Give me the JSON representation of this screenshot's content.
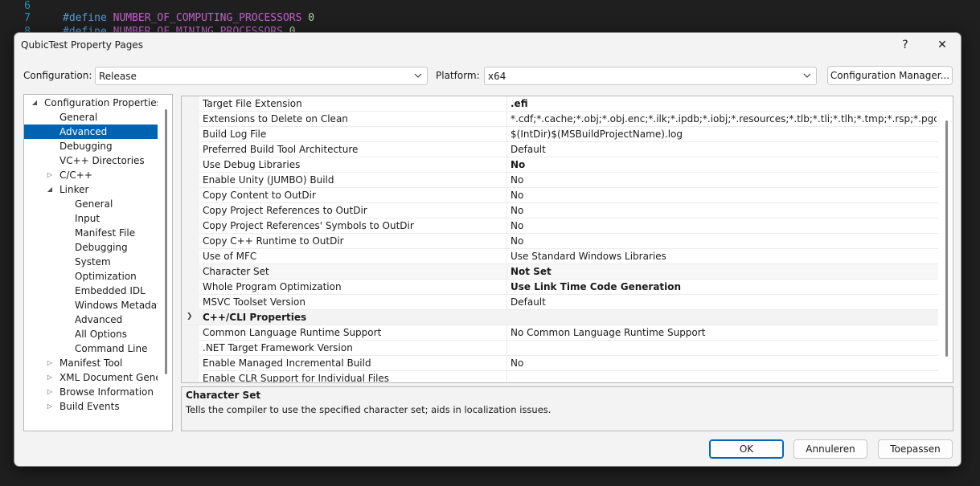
{
  "editor": {
    "lines": [
      {
        "number": "6",
        "keyword": "",
        "identifier": "",
        "value": ""
      },
      {
        "number": "7",
        "keyword": "#define",
        "identifier": "NUMBER_OF_COMPUTING_PROCESSORS",
        "value": "0"
      },
      {
        "number": "8",
        "keyword": "#define",
        "identifier": "NUMBER_OF_MINING_PROCESSORS",
        "value": "0"
      }
    ]
  },
  "dialog": {
    "title": "QubicTest Property Pages",
    "help_glyph": "?",
    "close_glyph": "✕",
    "configuration_label": "Configuration:",
    "configuration_value": "Release",
    "platform_label": "Platform:",
    "platform_value": "x64",
    "config_manager_label": "Configuration Manager..."
  },
  "tree": {
    "items": [
      {
        "label": "Configuration Properties",
        "expander": "◢"
      },
      {
        "label": "General",
        "expander": ""
      },
      {
        "label": "Advanced",
        "expander": ""
      },
      {
        "label": "Debugging",
        "expander": ""
      },
      {
        "label": "VC++ Directories",
        "expander": ""
      },
      {
        "label": "C/C++",
        "expander": "▷"
      },
      {
        "label": "Linker",
        "expander": "◢"
      },
      {
        "label": "General",
        "expander": ""
      },
      {
        "label": "Input",
        "expander": ""
      },
      {
        "label": "Manifest File",
        "expander": ""
      },
      {
        "label": "Debugging",
        "expander": ""
      },
      {
        "label": "System",
        "expander": ""
      },
      {
        "label": "Optimization",
        "expander": ""
      },
      {
        "label": "Embedded IDL",
        "expander": ""
      },
      {
        "label": "Windows Metadata",
        "expander": ""
      },
      {
        "label": "Advanced",
        "expander": ""
      },
      {
        "label": "All Options",
        "expander": ""
      },
      {
        "label": "Command Line",
        "expander": ""
      },
      {
        "label": "Manifest Tool",
        "expander": "▷"
      },
      {
        "label": "XML Document Genera",
        "expander": "▷"
      },
      {
        "label": "Browse Information",
        "expander": "▷"
      },
      {
        "label": "Build Events",
        "expander": "▷"
      }
    ]
  },
  "grid": {
    "rows": [
      {
        "name": "Target File Extension",
        "value": ".efi",
        "bold": true
      },
      {
        "name": "Extensions to Delete on Clean",
        "value": "*.cdf;*.cache;*.obj;*.obj.enc;*.ilk;*.ipdb;*.iobj;*.resources;*.tlb;*.tli;*.tlh;*.tmp;*.rsp;*.pgc;*.pgd;*.meta;*",
        "bold": false
      },
      {
        "name": "Build Log File",
        "value": "$(IntDir)$(MSBuildProjectName).log",
        "bold": false
      },
      {
        "name": "Preferred Build Tool Architecture",
        "value": "Default",
        "bold": false
      },
      {
        "name": "Use Debug Libraries",
        "value": "No",
        "bold": true
      },
      {
        "name": "Enable Unity (JUMBO) Build",
        "value": "No",
        "bold": false
      },
      {
        "name": "Copy Content to OutDir",
        "value": "No",
        "bold": false
      },
      {
        "name": "Copy Project References to OutDir",
        "value": "No",
        "bold": false
      },
      {
        "name": "Copy Project References' Symbols to OutDir",
        "value": "No",
        "bold": false
      },
      {
        "name": "Copy C++ Runtime to OutDir",
        "value": "No",
        "bold": false
      },
      {
        "name": "Use of MFC",
        "value": "Use Standard Windows Libraries",
        "bold": false
      },
      {
        "name": "Character Set",
        "value": "Not Set",
        "bold": true
      },
      {
        "name": "Whole Program Optimization",
        "value": "Use Link Time Code Generation",
        "bold": true
      },
      {
        "name": "MSVC Toolset Version",
        "value": "Default",
        "bold": false
      },
      {
        "name": "C++/CLI Properties",
        "value": "",
        "bold": false,
        "category": true
      },
      {
        "name": "Common Language Runtime Support",
        "value": "No Common Language Runtime Support",
        "bold": false
      },
      {
        "name": ".NET Target Framework Version",
        "value": "",
        "bold": false
      },
      {
        "name": "Enable Managed Incremental Build",
        "value": "No",
        "bold": false
      },
      {
        "name": "Enable CLR Support for Individual Files",
        "value": "",
        "bold": false
      }
    ]
  },
  "description": {
    "title": "Character Set",
    "text": "Tells the compiler to use the specified character set; aids in localization issues."
  },
  "buttons": {
    "ok": "OK",
    "cancel": "Annuleren",
    "apply": "Toepassen"
  }
}
